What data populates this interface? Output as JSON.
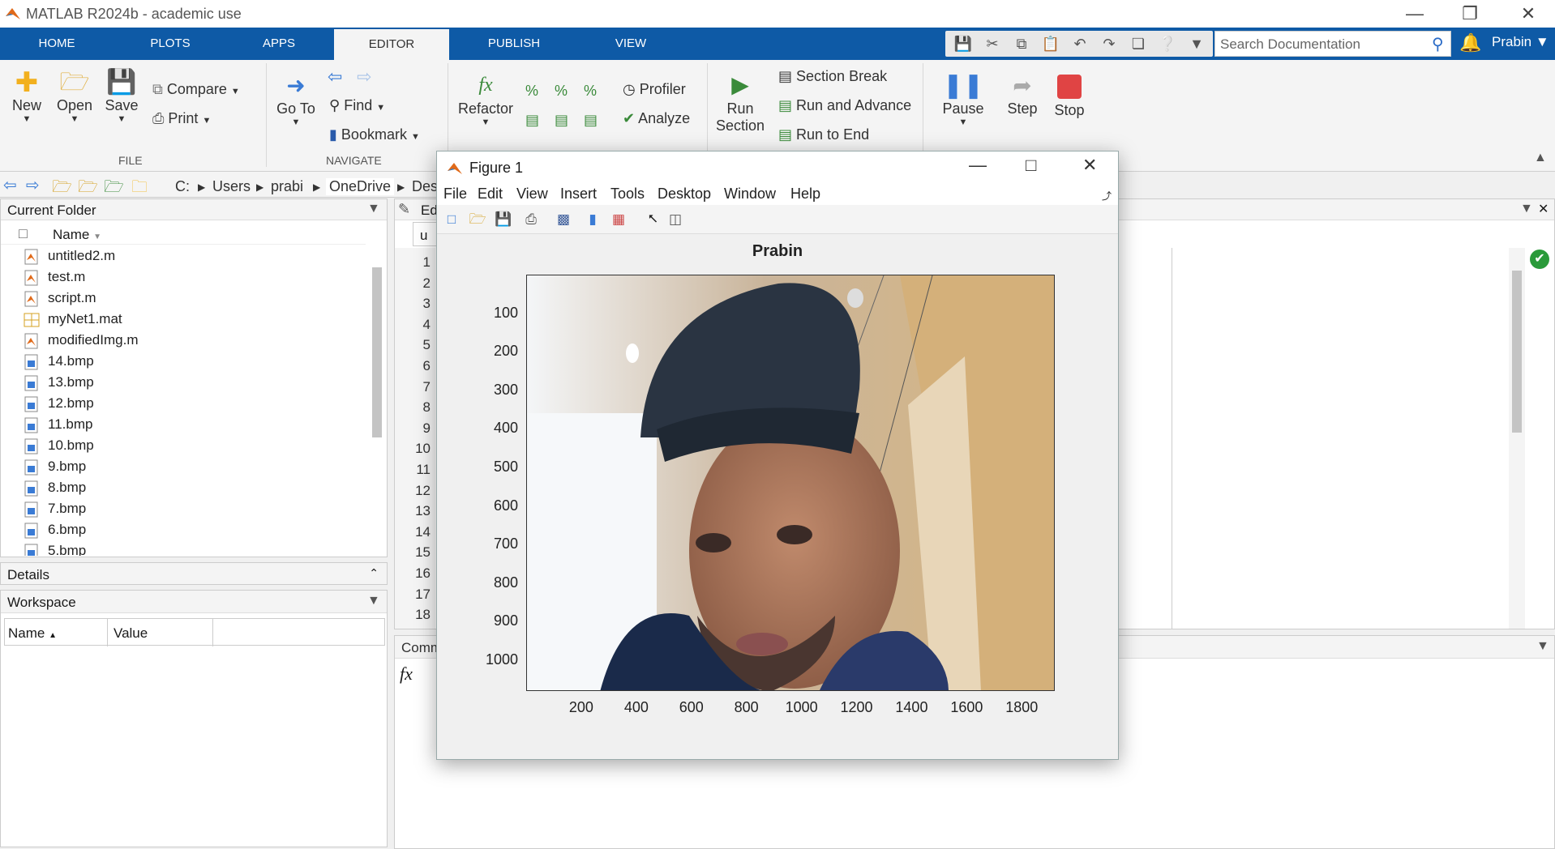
{
  "window": {
    "title": "MATLAB R2024b - academic use"
  },
  "tabs": [
    "HOME",
    "PLOTS",
    "APPS",
    "EDITOR",
    "PUBLISH",
    "VIEW"
  ],
  "active_tab": "EDITOR",
  "search": {
    "placeholder": "Search Documentation"
  },
  "user": "Prabin",
  "ribbon": {
    "file": {
      "label": "FILE",
      "new": "New",
      "open": "Open",
      "save": "Save",
      "compare": "Compare",
      "print": "Print"
    },
    "navigate": {
      "label": "NAVIGATE",
      "goto_l1": "Go To",
      "find": "Find",
      "bookmark": "Bookmark"
    },
    "code": {
      "refactor": "Refactor",
      "profiler": "Profiler",
      "analyze": "Analyze"
    },
    "section": {
      "run_l1": "Run",
      "run_l2": "Section",
      "section_break": "Section Break",
      "run_advance": "Run and Advance",
      "run_end": "Run to End"
    },
    "run": {
      "pause": "Pause",
      "step": "Step",
      "stop": "Stop"
    }
  },
  "address": [
    "C:",
    "Users",
    "prabi",
    "OneDrive",
    "Des"
  ],
  "current_folder": {
    "title": "Current Folder",
    "column": "Name",
    "files": [
      {
        "name": "untitled2.m",
        "type": "m"
      },
      {
        "name": "test.m",
        "type": "m"
      },
      {
        "name": "script.m",
        "type": "m"
      },
      {
        "name": "myNet1.mat",
        "type": "mat"
      },
      {
        "name": "modifiedImg.m",
        "type": "m"
      },
      {
        "name": "14.bmp",
        "type": "bmp"
      },
      {
        "name": "13.bmp",
        "type": "bmp"
      },
      {
        "name": "12.bmp",
        "type": "bmp"
      },
      {
        "name": "11.bmp",
        "type": "bmp"
      },
      {
        "name": "10.bmp",
        "type": "bmp"
      },
      {
        "name": "9.bmp",
        "type": "bmp"
      },
      {
        "name": "8.bmp",
        "type": "bmp"
      },
      {
        "name": "7.bmp",
        "type": "bmp"
      },
      {
        "name": "6.bmp",
        "type": "bmp"
      },
      {
        "name": "5.bmp",
        "type": "bmp"
      }
    ]
  },
  "details": {
    "title": "Details"
  },
  "workspace": {
    "title": "Workspace",
    "col_name": "Name",
    "col_value": "Value"
  },
  "editor": {
    "header_label": "Ed",
    "tab_label": "u",
    "line_numbers": [
      "1",
      "2",
      "3",
      "4",
      "5",
      "6",
      "7",
      "8",
      "9",
      "10",
      "11",
      "12",
      "13",
      "14",
      "15",
      "16",
      "17",
      "18"
    ]
  },
  "command_window": {
    "title": "Comm",
    "prompt": "fx"
  },
  "figure": {
    "title": "Figure 1",
    "menu": [
      "File",
      "Edit",
      "View",
      "Insert",
      "Tools",
      "Desktop",
      "Window",
      "Help"
    ],
    "plot_title": "Prabin",
    "x_ticks": [
      "200",
      "400",
      "600",
      "800",
      "1000",
      "1200",
      "1400",
      "1600",
      "1800"
    ],
    "y_ticks": [
      "100",
      "200",
      "300",
      "400",
      "500",
      "600",
      "700",
      "800",
      "900",
      "1000"
    ],
    "x_range": [
      0,
      1920
    ],
    "y_range": [
      0,
      1080
    ]
  },
  "colors": {
    "tabbar": "#0e5aa6",
    "ribbon": "#f4f4f4",
    "stop": "#e04444"
  }
}
